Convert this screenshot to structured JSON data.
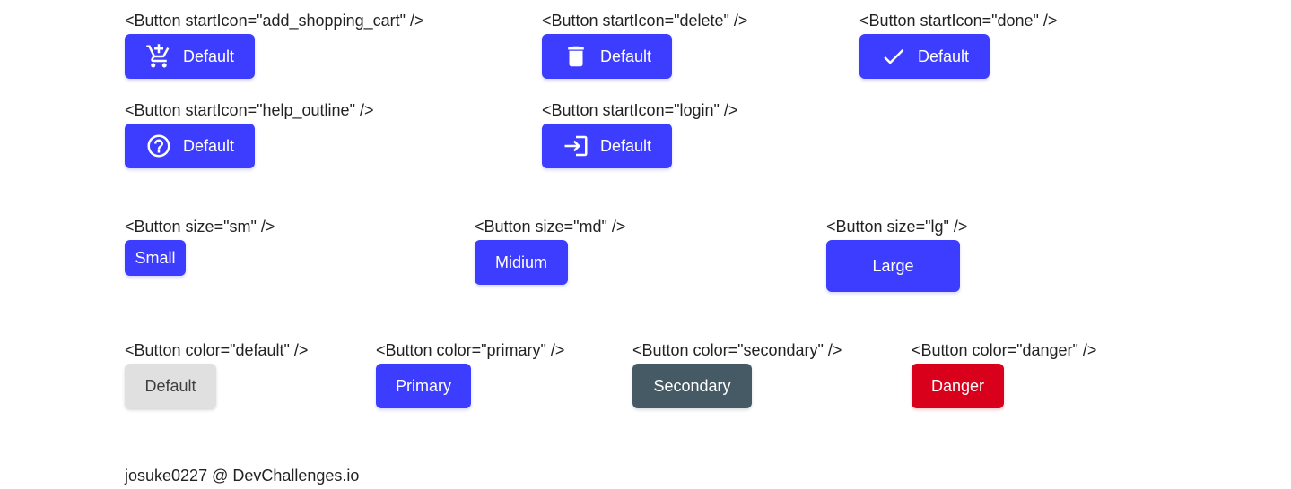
{
  "icon_demos": [
    {
      "caption": "<Button startIcon=\"add_shopping_cart\" />",
      "label": "Default",
      "icon": "add-shopping-cart-icon"
    },
    {
      "caption": "<Button startIcon=\"delete\" />",
      "label": "Default",
      "icon": "delete-icon"
    },
    {
      "caption": "<Button startIcon=\"done\" />",
      "label": "Default",
      "icon": "done-icon"
    },
    {
      "caption": "<Button startIcon=\"help_outline\" />",
      "label": "Default",
      "icon": "help-outline-icon"
    },
    {
      "caption": "<Button startIcon=\"login\" />",
      "label": "Default",
      "icon": "login-icon"
    }
  ],
  "size_demos": [
    {
      "caption": "<Button size=\"sm\" />",
      "label": "Small"
    },
    {
      "caption": "<Button size=\"md\" />",
      "label": "Midium"
    },
    {
      "caption": "<Button size=\"lg\" />",
      "label": "Large"
    }
  ],
  "color_demos": [
    {
      "caption": "<Button color=\"default\" />",
      "label": "Default",
      "color": "#e0e0e0"
    },
    {
      "caption": "<Button color=\"primary\" />",
      "label": "Primary",
      "color": "#3d3dff"
    },
    {
      "caption": "<Button color=\"secondary\" />",
      "label": "Secondary",
      "color": "#455a64"
    },
    {
      "caption": "<Button color=\"danger\" />",
      "label": "Danger",
      "color": "#d9001b"
    }
  ],
  "footer": {
    "text": "josuke0227 @ DevChallenges.io"
  }
}
